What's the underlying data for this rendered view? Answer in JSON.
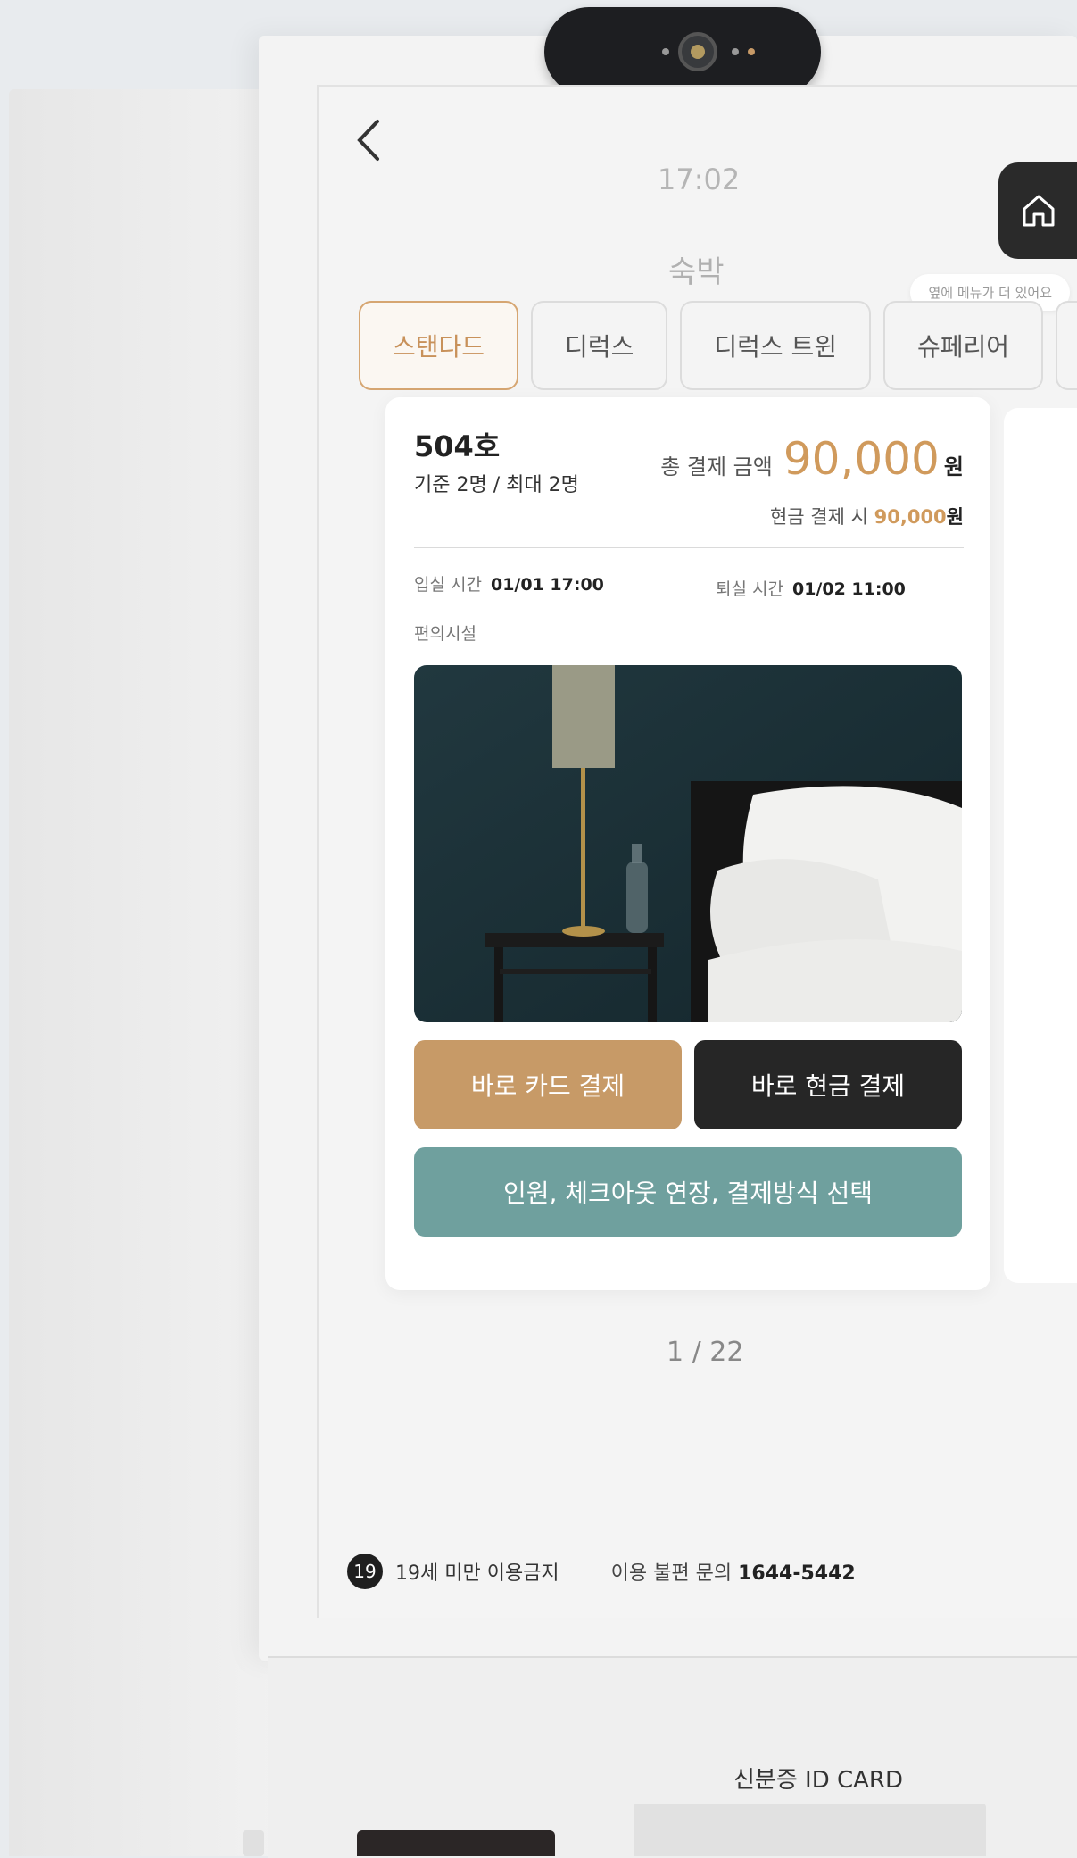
{
  "screen": {
    "clock": "17:02",
    "title": "숙박",
    "more_menu_hint": "옆에 메뉴가 더 있어요"
  },
  "tabs": [
    {
      "label": "스탠다드",
      "active": true
    },
    {
      "label": "디럭스",
      "active": false
    },
    {
      "label": "디럭스 트윈",
      "active": false
    },
    {
      "label": "슈페리어",
      "active": false
    }
  ],
  "room": {
    "number": "504호",
    "capacity": "기준 2명 / 최대 2명",
    "total_label": "총 결제 금액",
    "total_price": "90,000",
    "currency": "원",
    "cash_label": "현금 결제 시",
    "cash_price": "90,000",
    "checkin_label": "입실 시간",
    "checkin_time": "01/01 17:00",
    "checkout_label": "퇴실 시간",
    "checkout_time": "01/02 11:00",
    "amenities_label": "편의시설"
  },
  "actions": {
    "card_pay": "바로 카드 결제",
    "cash_pay": "바로 현금 결제",
    "options": "인원, 체크아웃 연장, 결제방식 선택"
  },
  "pager": "1 / 22",
  "footer": {
    "age_badge": "19",
    "age_notice": "19세 미만 이용금지",
    "support_label": "이용 불편 문의",
    "support_phone": "1644-5442"
  },
  "kiosk": {
    "id_card_label": "신분증 ID CARD"
  },
  "colors": {
    "accent": "#d09a5c",
    "card_button": "#c79a67",
    "cash_button": "#262626",
    "options_button": "#6fa09e"
  }
}
